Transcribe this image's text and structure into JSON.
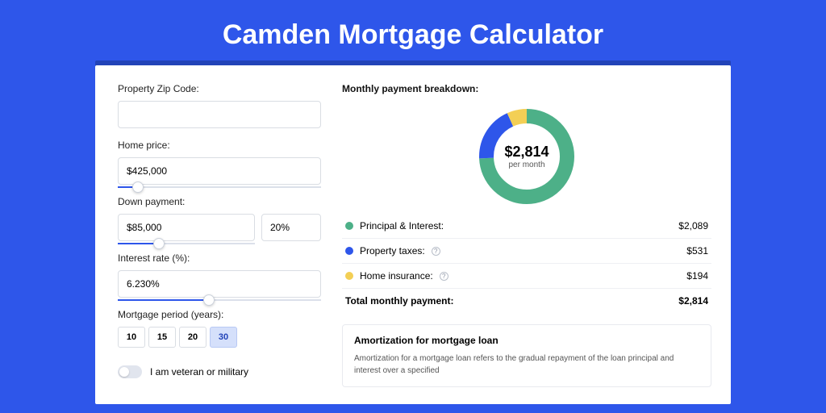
{
  "title": "Camden Mortgage Calculator",
  "form": {
    "zip_label": "Property Zip Code:",
    "zip_value": "",
    "home_price_label": "Home price:",
    "home_price_value": "$425,000",
    "home_price_slider_pct": 10,
    "down_label": "Down payment:",
    "down_value": "$85,000",
    "down_pct_value": "20%",
    "down_slider_pct": 30,
    "rate_label": "Interest rate (%):",
    "rate_value": "6.230%",
    "rate_slider_pct": 45,
    "period_label": "Mortgage period (years):",
    "periods": [
      "10",
      "15",
      "20",
      "30"
    ],
    "period_active_index": 3,
    "veteran_label": "I am veteran or military"
  },
  "breakdown": {
    "title": "Monthly payment breakdown:",
    "donut_amount": "$2,814",
    "donut_sub": "per month",
    "rows": [
      {
        "label": "Principal & Interest:",
        "value": "$2,089",
        "color": "#4db088",
        "help": false
      },
      {
        "label": "Property taxes:",
        "value": "$531",
        "color": "#2e56ea",
        "help": true
      },
      {
        "label": "Home insurance:",
        "value": "$194",
        "color": "#f3cf55",
        "help": true
      }
    ],
    "total_label": "Total monthly payment:",
    "total_value": "$2,814"
  },
  "chart_data": {
    "type": "pie",
    "title": "Monthly payment breakdown",
    "series": [
      {
        "name": "Principal & Interest",
        "value": 2089,
        "color": "#4db088"
      },
      {
        "name": "Property taxes",
        "value": 531,
        "color": "#2e56ea"
      },
      {
        "name": "Home insurance",
        "value": 194,
        "color": "#f3cf55"
      }
    ],
    "total": 2814
  },
  "amort": {
    "title": "Amortization for mortgage loan",
    "text": "Amortization for a mortgage loan refers to the gradual repayment of the loan principal and interest over a specified"
  }
}
